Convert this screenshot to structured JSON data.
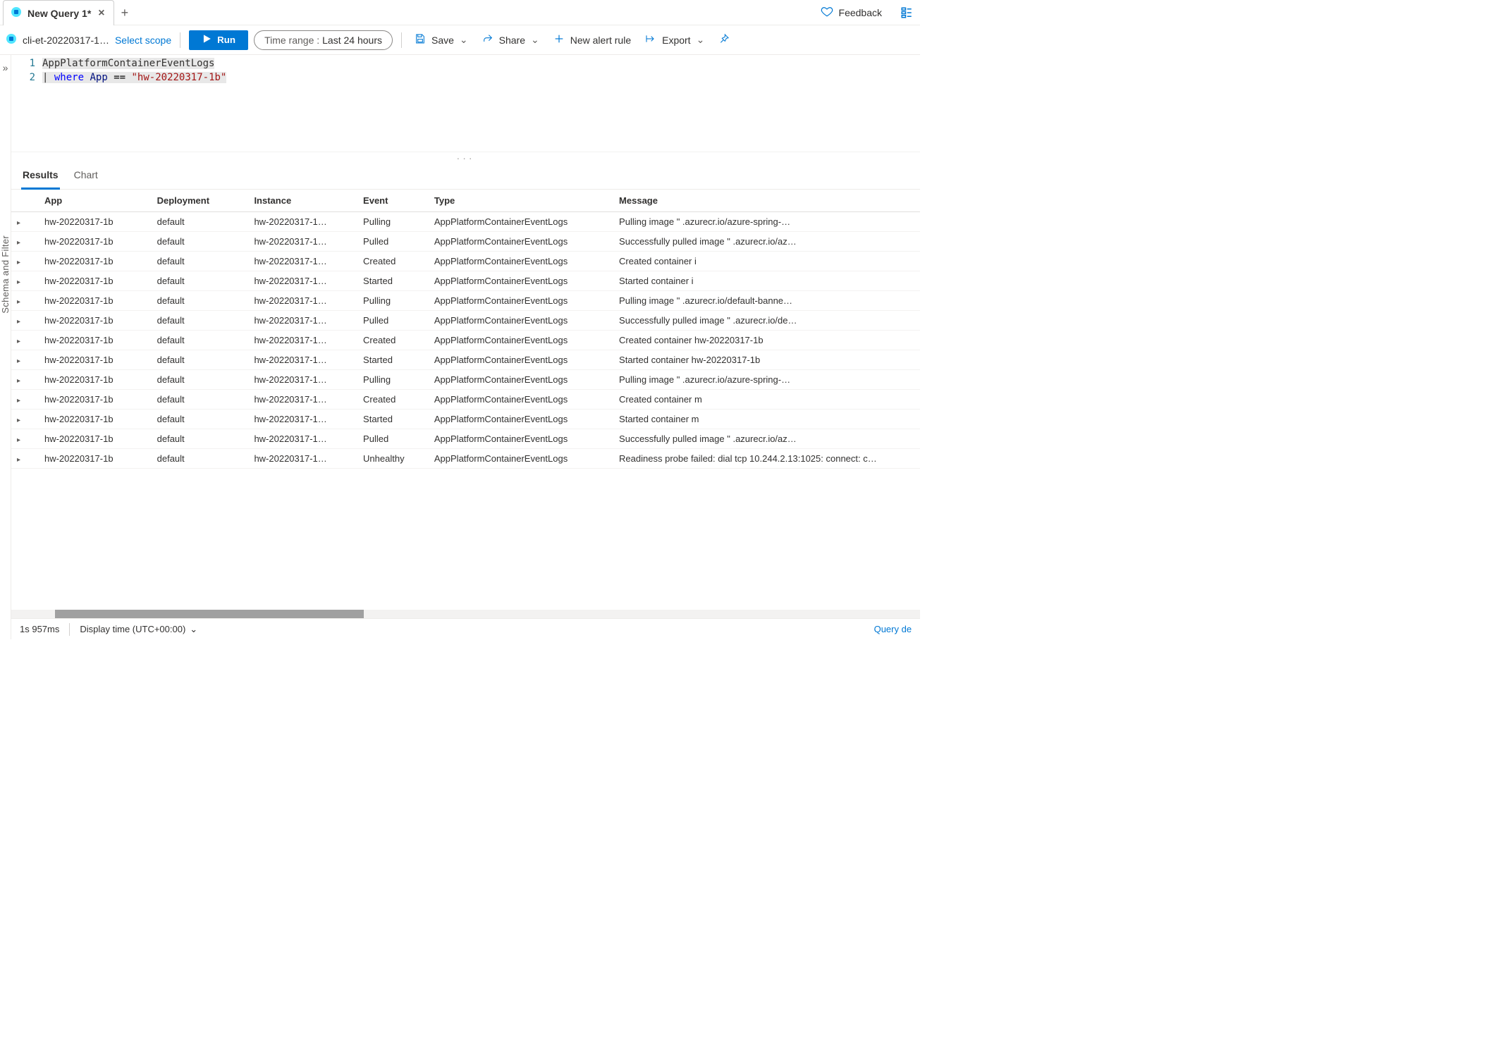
{
  "tab": {
    "title": "New Query 1*"
  },
  "top_right": {
    "feedback": "Feedback"
  },
  "toolbar": {
    "scope_name": "cli-et-20220317-1…",
    "select_scope": "Select scope",
    "run": "Run",
    "time_range_label": "Time range :",
    "time_range_value": "Last 24 hours",
    "save": "Save",
    "share": "Share",
    "new_alert": "New alert rule",
    "export": "Export"
  },
  "left_rail": {
    "label": "Schema and Filter"
  },
  "editor": {
    "lines": [
      {
        "num": "1"
      },
      {
        "num": "2"
      }
    ],
    "line1_table": "AppPlatformContainerEventLogs",
    "line2_pipe": "|",
    "line2_kw": "where",
    "line2_fld": "App",
    "line2_op": "==",
    "line2_str": "\"hw-20220317-1b\""
  },
  "result_tabs": {
    "results": "Results",
    "chart": "Chart"
  },
  "columns": [
    "App",
    "Deployment",
    "Instance",
    "Event",
    "Type",
    "Message"
  ],
  "rows": [
    {
      "app": "hw-20220317-1b",
      "deployment": "default",
      "instance": "hw-20220317-1…",
      "event": "Pulling",
      "type": "AppPlatformContainerEventLogs",
      "message": "Pulling image \"                                              .azurecr.io/azure-spring-…"
    },
    {
      "app": "hw-20220317-1b",
      "deployment": "default",
      "instance": "hw-20220317-1…",
      "event": "Pulled",
      "type": "AppPlatformContainerEventLogs",
      "message": "Successfully pulled image \"                                              .azurecr.io/az…"
    },
    {
      "app": "hw-20220317-1b",
      "deployment": "default",
      "instance": "hw-20220317-1…",
      "event": "Created",
      "type": "AppPlatformContainerEventLogs",
      "message": "Created container i"
    },
    {
      "app": "hw-20220317-1b",
      "deployment": "default",
      "instance": "hw-20220317-1…",
      "event": "Started",
      "type": "AppPlatformContainerEventLogs",
      "message": "Started container i"
    },
    {
      "app": "hw-20220317-1b",
      "deployment": "default",
      "instance": "hw-20220317-1…",
      "event": "Pulling",
      "type": "AppPlatformContainerEventLogs",
      "message": "Pulling image \"                                              .azurecr.io/default-banne…"
    },
    {
      "app": "hw-20220317-1b",
      "deployment": "default",
      "instance": "hw-20220317-1…",
      "event": "Pulled",
      "type": "AppPlatformContainerEventLogs",
      "message": "Successfully pulled image \"                                              .azurecr.io/de…"
    },
    {
      "app": "hw-20220317-1b",
      "deployment": "default",
      "instance": "hw-20220317-1…",
      "event": "Created",
      "type": "AppPlatformContainerEventLogs",
      "message": "Created container hw-20220317-1b"
    },
    {
      "app": "hw-20220317-1b",
      "deployment": "default",
      "instance": "hw-20220317-1…",
      "event": "Started",
      "type": "AppPlatformContainerEventLogs",
      "message": "Started container hw-20220317-1b"
    },
    {
      "app": "hw-20220317-1b",
      "deployment": "default",
      "instance": "hw-20220317-1…",
      "event": "Pulling",
      "type": "AppPlatformContainerEventLogs",
      "message": "Pulling image \"                                              .azurecr.io/azure-spring-…"
    },
    {
      "app": "hw-20220317-1b",
      "deployment": "default",
      "instance": "hw-20220317-1…",
      "event": "Created",
      "type": "AppPlatformContainerEventLogs",
      "message": "Created container m"
    },
    {
      "app": "hw-20220317-1b",
      "deployment": "default",
      "instance": "hw-20220317-1…",
      "event": "Started",
      "type": "AppPlatformContainerEventLogs",
      "message": "Started container m"
    },
    {
      "app": "hw-20220317-1b",
      "deployment": "default",
      "instance": "hw-20220317-1…",
      "event": "Pulled",
      "type": "AppPlatformContainerEventLogs",
      "message": "Successfully pulled image \"                                              .azurecr.io/az…"
    },
    {
      "app": "hw-20220317-1b",
      "deployment": "default",
      "instance": "hw-20220317-1…",
      "event": "Unhealthy",
      "type": "AppPlatformContainerEventLogs",
      "message": "Readiness probe failed: dial tcp 10.244.2.13:1025: connect: c…"
    }
  ],
  "status": {
    "timing": "1s 957ms",
    "tz": "Display time (UTC+00:00)",
    "query_details": "Query de"
  }
}
